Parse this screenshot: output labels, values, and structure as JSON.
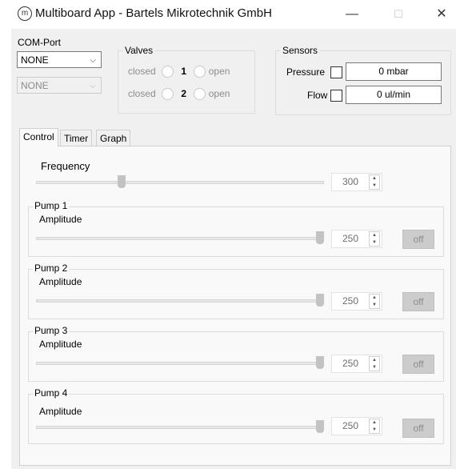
{
  "window": {
    "icon_letter": "m",
    "title": "Multiboard App - Bartels Mikrotechnik GmbH",
    "minimize": "—",
    "maximize": "☐",
    "close": "✕"
  },
  "com_port": {
    "label": "COM-Port",
    "port1": "NONE",
    "port2": "NONE"
  },
  "valves": {
    "label": "Valves",
    "rows": [
      {
        "closed": "closed",
        "number": "1",
        "open": "open"
      },
      {
        "closed": "closed",
        "number": "2",
        "open": "open"
      }
    ]
  },
  "sensors": {
    "label": "Sensors",
    "pressure_label": "Pressure",
    "pressure_value": "0 mbar",
    "flow_label": "Flow",
    "flow_value": "0 ul/min"
  },
  "tabs": [
    "Control",
    "Timer",
    "Graph"
  ],
  "frequency": {
    "label": "Frequency",
    "value": "300",
    "level": 0.29
  },
  "pumps": [
    {
      "title": "Pump 1",
      "amplitude_label": "Amplitude",
      "value": "250",
      "level": 1.0,
      "button": "off"
    },
    {
      "title": "Pump 2",
      "amplitude_label": "Amplitude",
      "value": "250",
      "level": 1.0,
      "button": "off"
    },
    {
      "title": "Pump 3",
      "amplitude_label": "Amplitude",
      "value": "250",
      "level": 1.0,
      "button": "off"
    },
    {
      "title": "Pump 4",
      "amplitude_label": "Amplitude",
      "value": "250",
      "level": 1.0,
      "button": "off"
    }
  ],
  "icons": {
    "spin_up": "▲",
    "spin_down": "▼",
    "combo_arrow": "⌵"
  }
}
